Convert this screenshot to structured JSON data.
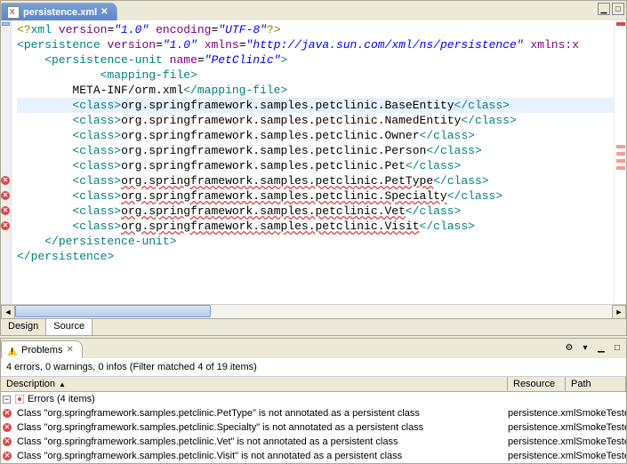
{
  "tab": {
    "filename": "persistence.xml"
  },
  "ruler_errors_at": [
    205,
    222,
    239,
    256
  ],
  "overview_marks_at": [
    140,
    148,
    156,
    164
  ],
  "lines": [
    {
      "type": "decl",
      "parts": [
        {
          "t": "<?",
          "cls": "c-decl"
        },
        {
          "t": "xml ",
          "cls": "c-tag"
        },
        {
          "t": "version",
          "cls": "c-attrn"
        },
        {
          "t": "=",
          "cls": "c-text"
        },
        {
          "t": "\"1.0\"",
          "cls": "c-attrv"
        },
        {
          "t": " ",
          "cls": ""
        },
        {
          "t": "encoding",
          "cls": "c-attrn"
        },
        {
          "t": "=",
          "cls": "c-text"
        },
        {
          "t": "\"UTF-8\"",
          "cls": "c-attrv"
        },
        {
          "t": "?>",
          "cls": "c-decl"
        }
      ]
    },
    {
      "indent": 0,
      "parts": [
        {
          "t": "<",
          "cls": "c-tag"
        },
        {
          "t": "persistence",
          "cls": "c-tag"
        },
        {
          "t": " ",
          "cls": ""
        },
        {
          "t": "version",
          "cls": "c-attrn"
        },
        {
          "t": "=",
          "cls": "c-text"
        },
        {
          "t": "\"1.0\"",
          "cls": "c-attrv"
        },
        {
          "t": " ",
          "cls": ""
        },
        {
          "t": "xmlns",
          "cls": "c-attrn"
        },
        {
          "t": "=",
          "cls": "c-text"
        },
        {
          "t": "\"http://java.sun.com/xml/ns/persistence\"",
          "cls": "c-attrv"
        },
        {
          "t": " ",
          "cls": ""
        },
        {
          "t": "xmlns:x",
          "cls": "c-attrn"
        }
      ]
    },
    {
      "indent": 1,
      "parts": [
        {
          "t": "<",
          "cls": "c-tag"
        },
        {
          "t": "persistence-unit",
          "cls": "c-tag"
        },
        {
          "t": " ",
          "cls": ""
        },
        {
          "t": "name",
          "cls": "c-attrn"
        },
        {
          "t": "=",
          "cls": "c-text"
        },
        {
          "t": "\"PetClinic\"",
          "cls": "c-attrv"
        },
        {
          "t": ">",
          "cls": "c-tag"
        }
      ]
    },
    {
      "indent": 3,
      "parts": [
        {
          "t": "<",
          "cls": "c-tag"
        },
        {
          "t": "mapping-file",
          "cls": "c-tag"
        },
        {
          "t": ">",
          "cls": "c-tag"
        }
      ]
    },
    {
      "indent": 2,
      "parts": [
        {
          "t": "META-INF/orm.xml",
          "cls": "c-text"
        },
        {
          "t": "</",
          "cls": "c-tag"
        },
        {
          "t": "mapping-file",
          "cls": "c-tag"
        },
        {
          "t": ">",
          "cls": "c-tag"
        }
      ]
    },
    {
      "indent": 2,
      "hl": true,
      "parts": [
        {
          "t": "<",
          "cls": "c-tag"
        },
        {
          "t": "class",
          "cls": "c-tag"
        },
        {
          "t": ">",
          "cls": "c-tag"
        },
        {
          "t": "org.springframework.samples.petclinic.BaseEntity",
          "cls": "c-text"
        },
        {
          "t": "</",
          "cls": "c-tag"
        },
        {
          "t": "class",
          "cls": "c-tag"
        },
        {
          "t": ">",
          "cls": "c-tag"
        }
      ]
    },
    {
      "indent": 2,
      "parts": [
        {
          "t": "<",
          "cls": "c-tag"
        },
        {
          "t": "class",
          "cls": "c-tag"
        },
        {
          "t": ">",
          "cls": "c-tag"
        },
        {
          "t": "org.springframework.samples.petclinic.NamedEntity",
          "cls": "c-text"
        },
        {
          "t": "</",
          "cls": "c-tag"
        },
        {
          "t": "class",
          "cls": "c-tag"
        },
        {
          "t": ">",
          "cls": "c-tag"
        }
      ]
    },
    {
      "indent": 2,
      "parts": [
        {
          "t": "<",
          "cls": "c-tag"
        },
        {
          "t": "class",
          "cls": "c-tag"
        },
        {
          "t": ">",
          "cls": "c-tag"
        },
        {
          "t": "org.springframework.samples.petclinic.Owner",
          "cls": "c-text"
        },
        {
          "t": "</",
          "cls": "c-tag"
        },
        {
          "t": "class",
          "cls": "c-tag"
        },
        {
          "t": ">",
          "cls": "c-tag"
        }
      ]
    },
    {
      "indent": 2,
      "parts": [
        {
          "t": "<",
          "cls": "c-tag"
        },
        {
          "t": "class",
          "cls": "c-tag"
        },
        {
          "t": ">",
          "cls": "c-tag"
        },
        {
          "t": "org.springframework.samples.petclinic.Person",
          "cls": "c-text"
        },
        {
          "t": "</",
          "cls": "c-tag"
        },
        {
          "t": "class",
          "cls": "c-tag"
        },
        {
          "t": ">",
          "cls": "c-tag"
        }
      ]
    },
    {
      "indent": 2,
      "parts": [
        {
          "t": "<",
          "cls": "c-tag"
        },
        {
          "t": "class",
          "cls": "c-tag"
        },
        {
          "t": ">",
          "cls": "c-tag"
        },
        {
          "t": "org.springframework.samples.petclinic.Pet",
          "cls": "c-text"
        },
        {
          "t": "</",
          "cls": "c-tag"
        },
        {
          "t": "class",
          "cls": "c-tag"
        },
        {
          "t": ">",
          "cls": "c-tag"
        }
      ]
    },
    {
      "indent": 2,
      "err": true,
      "parts": [
        {
          "t": "<",
          "cls": "c-tag"
        },
        {
          "t": "class",
          "cls": "c-tag"
        },
        {
          "t": ">",
          "cls": "c-tag"
        },
        {
          "t": "org.springframework.samples.petclinic.PetType",
          "cls": "c-text c-err"
        },
        {
          "t": "</",
          "cls": "c-tag"
        },
        {
          "t": "class",
          "cls": "c-tag"
        },
        {
          "t": ">",
          "cls": "c-tag"
        }
      ]
    },
    {
      "indent": 2,
      "err": true,
      "parts": [
        {
          "t": "<",
          "cls": "c-tag"
        },
        {
          "t": "class",
          "cls": "c-tag"
        },
        {
          "t": ">",
          "cls": "c-tag"
        },
        {
          "t": "org.springframework.samples.petclinic.Specialty",
          "cls": "c-text c-err"
        },
        {
          "t": "</",
          "cls": "c-tag"
        },
        {
          "t": "class",
          "cls": "c-tag"
        },
        {
          "t": ">",
          "cls": "c-tag"
        }
      ]
    },
    {
      "indent": 2,
      "err": true,
      "parts": [
        {
          "t": "<",
          "cls": "c-tag"
        },
        {
          "t": "class",
          "cls": "c-tag"
        },
        {
          "t": ">",
          "cls": "c-tag"
        },
        {
          "t": "org.springframework.samples.petclinic.Vet",
          "cls": "c-text c-err"
        },
        {
          "t": "</",
          "cls": "c-tag"
        },
        {
          "t": "class",
          "cls": "c-tag"
        },
        {
          "t": ">",
          "cls": "c-tag"
        }
      ]
    },
    {
      "indent": 2,
      "err": true,
      "parts": [
        {
          "t": "<",
          "cls": "c-tag"
        },
        {
          "t": "class",
          "cls": "c-tag"
        },
        {
          "t": ">",
          "cls": "c-tag"
        },
        {
          "t": "org.springframework.samples.petclinic.Visit",
          "cls": "c-text c-err"
        },
        {
          "t": "</",
          "cls": "c-tag"
        },
        {
          "t": "class",
          "cls": "c-tag"
        },
        {
          "t": ">",
          "cls": "c-tag"
        }
      ]
    },
    {
      "indent": 1,
      "parts": [
        {
          "t": "</",
          "cls": "c-tag"
        },
        {
          "t": "persistence-unit",
          "cls": "c-tag"
        },
        {
          "t": ">",
          "cls": "c-tag"
        }
      ]
    },
    {
      "indent": 0,
      "parts": [
        {
          "t": "</",
          "cls": "c-tag"
        },
        {
          "t": "persistence",
          "cls": "c-tag"
        },
        {
          "t": ">",
          "cls": "c-tag"
        }
      ]
    }
  ],
  "bottom_tabs": {
    "design": "Design",
    "source": "Source"
  },
  "problems": {
    "title": "Problems",
    "summary": "4 errors, 0 warnings, 0 infos (Filter matched 4 of 19 items)",
    "columns": {
      "desc": "Description",
      "res": "Resource",
      "path": "Path"
    },
    "group": "Errors (4 items)",
    "items": [
      {
        "desc": "Class \"org.springframework.samples.petclinic.PetType\" is not annotated as a persistent class",
        "res": "persistence.xml",
        "path": "SmokeTester/sr"
      },
      {
        "desc": "Class \"org.springframework.samples.petclinic.Specialty\" is not annotated as a persistent class",
        "res": "persistence.xml",
        "path": "SmokeTester/sr"
      },
      {
        "desc": "Class \"org.springframework.samples.petclinic.Vet\" is not annotated as a persistent class",
        "res": "persistence.xml",
        "path": "SmokeTester/sr"
      },
      {
        "desc": "Class \"org.springframework.samples.petclinic.Visit\" is not annotated as a persistent class",
        "res": "persistence.xml",
        "path": "SmokeTester/sr"
      }
    ]
  }
}
